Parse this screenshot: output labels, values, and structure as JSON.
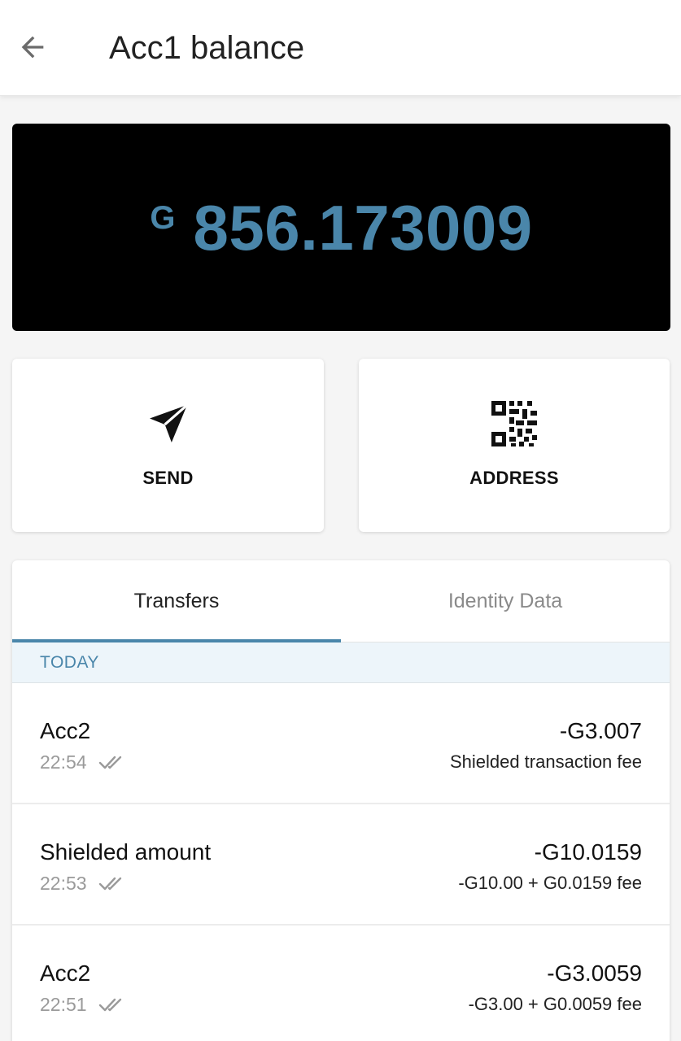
{
  "header": {
    "title": "Acc1 balance",
    "back_icon": "arrow-back-icon"
  },
  "balance": {
    "currency_symbol": "G",
    "amount": "856.173009",
    "accent_color": "#4a86aa",
    "background_color": "#000000"
  },
  "actions": {
    "send": {
      "label": "SEND",
      "icon": "send-icon"
    },
    "address": {
      "label": "ADDRESS",
      "icon": "qr-code-icon"
    }
  },
  "tabs": [
    {
      "label": "Transfers",
      "active": true
    },
    {
      "label": "Identity Data",
      "active": false
    }
  ],
  "transfers": {
    "section_label": "TODAY",
    "items": [
      {
        "name": "Acc2",
        "time": "22:54",
        "amount": "-G3.007",
        "detail": "Shielded transaction fee"
      },
      {
        "name": "Shielded amount",
        "time": "22:53",
        "amount": "-G10.0159",
        "detail": "-G10.00 + G0.0159 fee"
      },
      {
        "name": "Acc2",
        "time": "22:51",
        "amount": "-G3.0059",
        "detail": "-G3.00 + G0.0059 fee"
      }
    ]
  }
}
